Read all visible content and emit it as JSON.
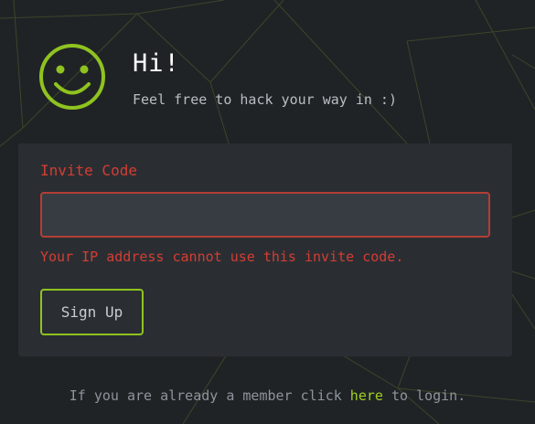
{
  "colors": {
    "background": "#202326",
    "card": "#2a2e33",
    "accent": "#8fc31f",
    "error": "#d53d32",
    "link": "#9fd120"
  },
  "header": {
    "logo_icon": "smiley-face-icon",
    "title": "Hi!",
    "subtitle": "Feel free to hack your way in :)"
  },
  "form": {
    "label": "Invite Code",
    "input_value": "",
    "input_placeholder": "",
    "error": "Your IP address cannot use this invite code.",
    "submit_label": "Sign Up"
  },
  "footer": {
    "text_before": "If you are already a member click ",
    "link_text": "here",
    "text_after": " to login."
  }
}
